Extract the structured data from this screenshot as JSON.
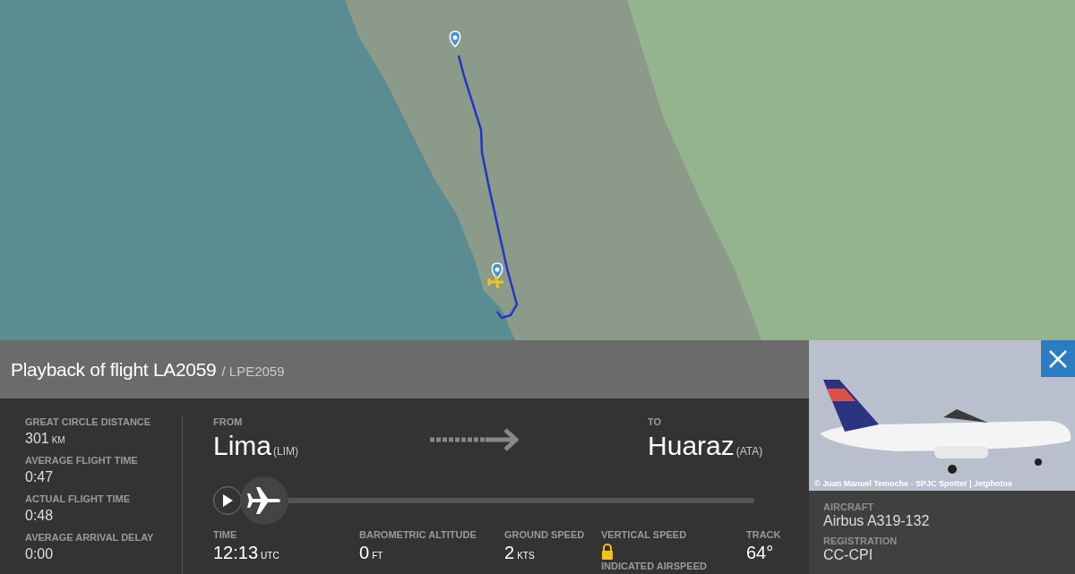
{
  "header": {
    "title": "Playback of flight LA2059",
    "subtitle": "/ LPE2059"
  },
  "stats": [
    {
      "label": "GREAT CIRCLE DISTANCE",
      "value": "301",
      "unit": "KM"
    },
    {
      "label": "AVERAGE FLIGHT TIME",
      "value": "0:47"
    },
    {
      "label": "ACTUAL FLIGHT TIME",
      "value": "0:48"
    },
    {
      "label": "AVERAGE ARRIVAL DELAY",
      "value": "0:00"
    }
  ],
  "route": {
    "from_label": "FROM",
    "from_city": "Lima",
    "from_code": "(LIM)",
    "to_label": "TO",
    "to_city": "Huaraz",
    "to_code": "(ATA)"
  },
  "playback": {
    "level": 0
  },
  "readouts": [
    {
      "kind": "value",
      "label": "TIME",
      "value": "12:13",
      "unit": "UTC"
    },
    {
      "kind": "value",
      "label": "BAROMETRIC ALTITUDE",
      "value": "0",
      "unit": "FT"
    },
    {
      "kind": "value",
      "label": "GROUND SPEED",
      "value": "2",
      "unit": "KTS"
    },
    {
      "kind": "locked",
      "label": "VERTICAL SPEED",
      "sublabel": "INDICATED AIRSPEED"
    },
    {
      "kind": "value",
      "label": "TRACK",
      "value": "64°"
    }
  ],
  "aircraft": {
    "photo_credit": "© Juan Manuel Temoche - SPJC Spotter | Jetphotos",
    "fields": [
      {
        "label": "AIRCRAFT",
        "value": "Airbus A319-132"
      },
      {
        "label": "REGISTRATION",
        "value": "CC-CPI"
      }
    ]
  }
}
